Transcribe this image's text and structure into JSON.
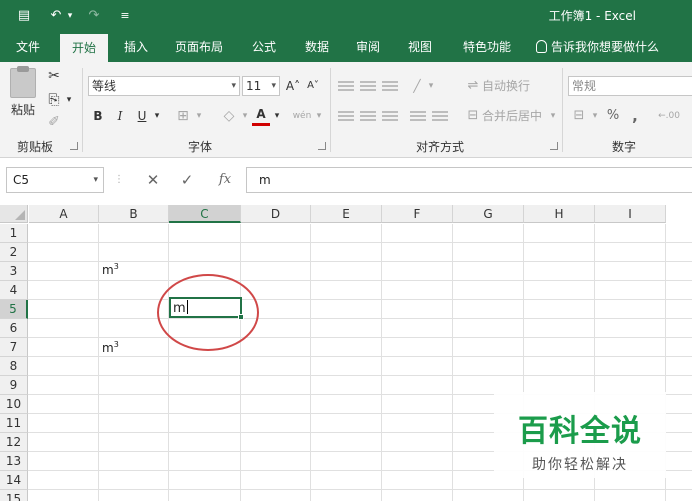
{
  "window": {
    "title": "工作簿1  -  Excel"
  },
  "quick_access": {
    "save": "▤",
    "undo": "↶",
    "undo_drop": "▾",
    "redo": "↷",
    "customize": "≡"
  },
  "menu": {
    "tabs": [
      "文件",
      "开始",
      "插入",
      "页面布局",
      "公式",
      "数据",
      "审阅",
      "视图",
      "特色功能"
    ],
    "active_tab": "开始",
    "tell_me": "告诉我你想要做什么"
  },
  "ribbon": {
    "clipboard": {
      "paste": "粘贴",
      "cut": "✂",
      "copy": "⎘",
      "brush": "✐",
      "group": "剪贴板"
    },
    "font": {
      "family": "等线",
      "size": "11",
      "grow": "A˄",
      "shrink": "A˅",
      "bold": "B",
      "italic": "I",
      "underline": "U",
      "border": "⊞",
      "fill": "◇",
      "color": "A",
      "wen": "wén",
      "group": "字体"
    },
    "alignment": {
      "wrap": "自动换行",
      "merge": "合并后居中",
      "orient": "╱",
      "group": "对齐方式"
    },
    "number": {
      "format": "常规",
      "currency": "⊟",
      "percent": "%",
      "comma": ",",
      "inc_dec": "←.00",
      "dec_dec": ".00",
      "group": "数字"
    }
  },
  "formula_bar": {
    "name_box": "C5",
    "cancel": "✕",
    "enter": "✓",
    "fx": "fx",
    "content": "m"
  },
  "grid": {
    "columns": [
      "A",
      "B",
      "C",
      "D",
      "E",
      "F",
      "G",
      "H",
      "I"
    ],
    "rows": [
      "1",
      "2",
      "3",
      "4",
      "5",
      "6",
      "7",
      "8",
      "9",
      "10",
      "11",
      "12",
      "13",
      "14",
      "15"
    ],
    "selected_column": "C",
    "selected_row": "5",
    "cells": {
      "B3": {
        "base": "m",
        "sup": "3"
      },
      "B7": {
        "base": "m",
        "sup": "3"
      }
    },
    "editing_cell": {
      "ref": "C5",
      "text": "m"
    }
  },
  "watermark": {
    "title": "百科全说",
    "subtitle": "助你轻松解决"
  },
  "colors": {
    "excel_green": "#217346",
    "highlight_red": "#d04848",
    "watermark_green": "#1b9c4b"
  }
}
